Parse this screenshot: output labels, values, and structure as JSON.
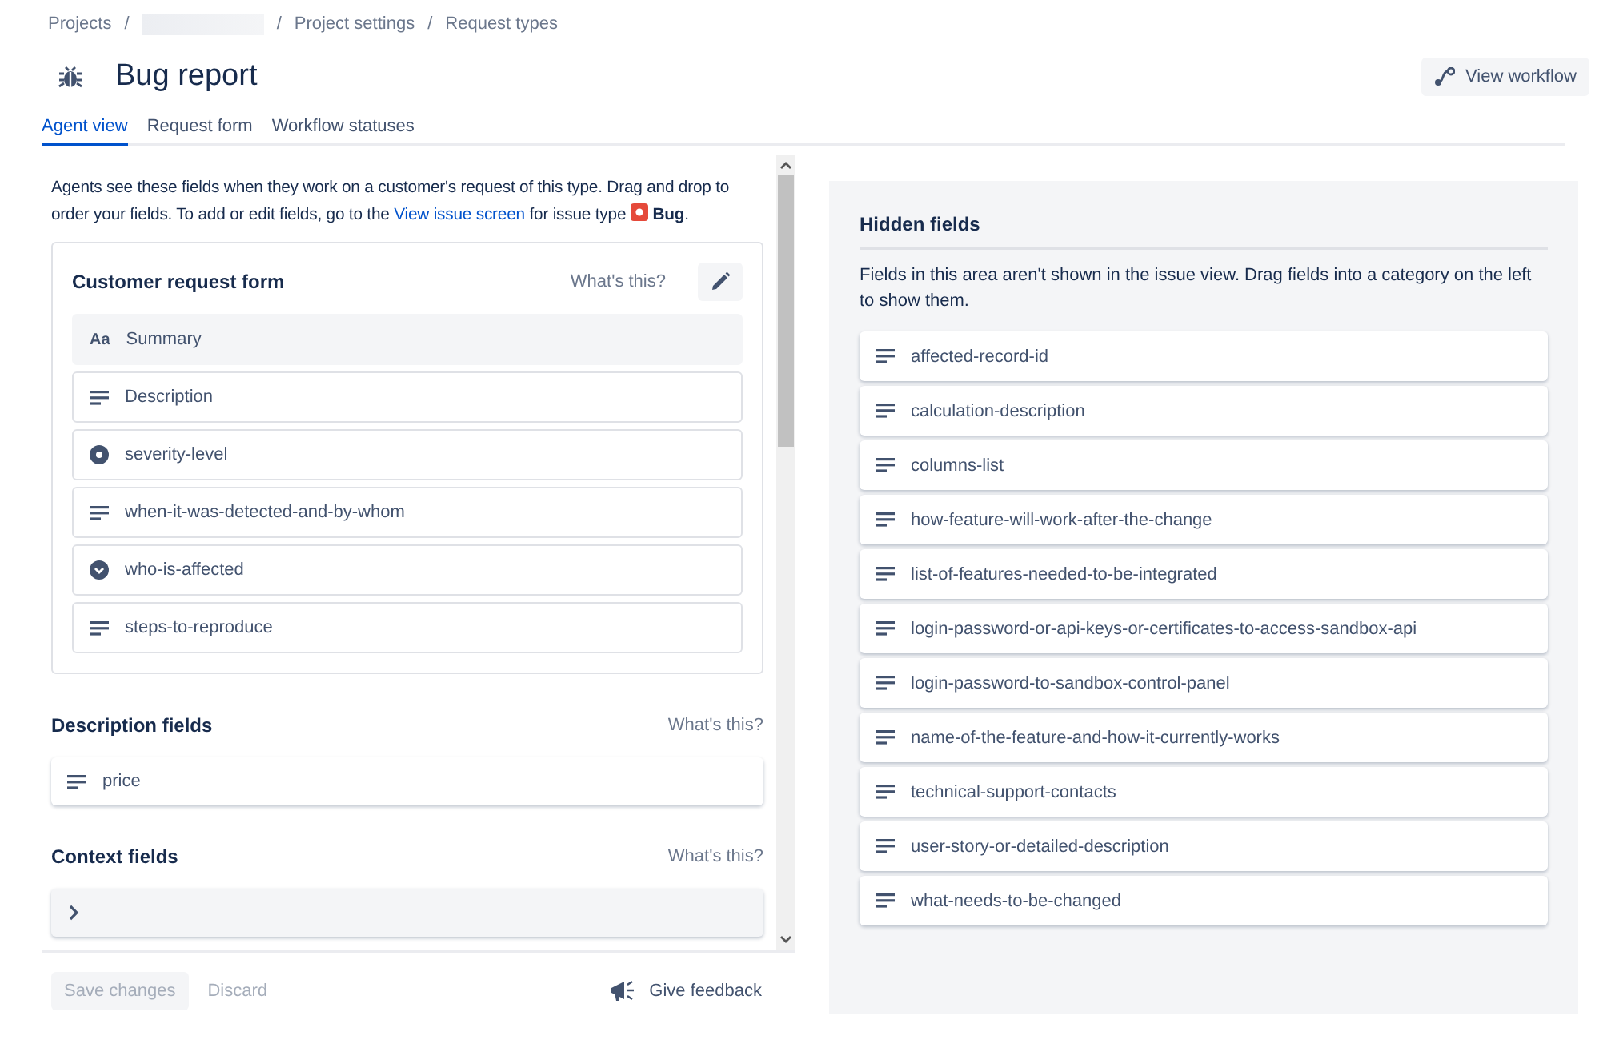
{
  "breadcrumbs": {
    "items": [
      "Projects",
      "Project settings",
      "Request types"
    ],
    "separator": "/"
  },
  "header": {
    "title": "Bug report",
    "action": "View workflow"
  },
  "tabs": [
    {
      "label": "Agent view",
      "selected": true
    },
    {
      "label": "Request form",
      "selected": false
    },
    {
      "label": "Workflow statuses",
      "selected": false
    }
  ],
  "intro": {
    "text": "Agents see these fields when they work on a customer's request of this type. Drag and drop to order your fields. To add or edit fields, go to the",
    "link": "View issue screen",
    "after": "for issue type",
    "issue_type": "Bug",
    "end": "."
  },
  "sections": [
    {
      "title": "Customer request form",
      "help": "What's this?",
      "editable": true,
      "fields": [
        {
          "label": "Summary",
          "kind": "summary",
          "icon_text": "Aa"
        },
        {
          "label": "Description",
          "kind": "paragraph"
        },
        {
          "label": "severity-level",
          "kind": "radio"
        },
        {
          "label": "when-it-was-detected-and-by-whom",
          "kind": "paragraph"
        },
        {
          "label": "who-is-affected",
          "kind": "select"
        },
        {
          "label": "steps-to-reproduce",
          "kind": "paragraph"
        }
      ]
    },
    {
      "title": "Description fields",
      "help": "What's this?",
      "editable": false,
      "fields": [
        {
          "label": "price",
          "kind": "paragraph"
        }
      ]
    },
    {
      "title": "Context fields",
      "help": "What's this?",
      "editable": false,
      "fields": [
        {
          "kind": "group"
        }
      ]
    }
  ],
  "footer": {
    "buttons": [
      {
        "label": "Save changes",
        "disabled": true
      },
      {
        "label": "Discard",
        "disabled": true
      }
    ],
    "feedback": "Give feedback"
  },
  "hidden_fields": {
    "title": "Hidden fields",
    "description": "Fields in this area aren't shown in the issue view. Drag fields into a category on the left to show them.",
    "fields": [
      {
        "label": "affected-record-id",
        "kind": "paragraph"
      },
      {
        "label": "calculation-description",
        "kind": "paragraph"
      },
      {
        "label": "columns-list",
        "kind": "paragraph"
      },
      {
        "label": "how-feature-will-work-after-the-change",
        "kind": "paragraph"
      },
      {
        "label": "list-of-features-needed-to-be-integrated",
        "kind": "paragraph"
      },
      {
        "label": "login-password-or-api-keys-or-certificates-to-access-sandbox-api",
        "kind": "paragraph"
      },
      {
        "label": "login-password-to-sandbox-control-panel",
        "kind": "paragraph"
      },
      {
        "label": "name-of-the-feature-and-how-it-currently-works",
        "kind": "paragraph"
      },
      {
        "label": "technical-support-contacts",
        "kind": "paragraph"
      },
      {
        "label": "user-story-or-detailed-description",
        "kind": "paragraph"
      },
      {
        "label": "what-needs-to-be-changed",
        "kind": "paragraph"
      }
    ]
  }
}
